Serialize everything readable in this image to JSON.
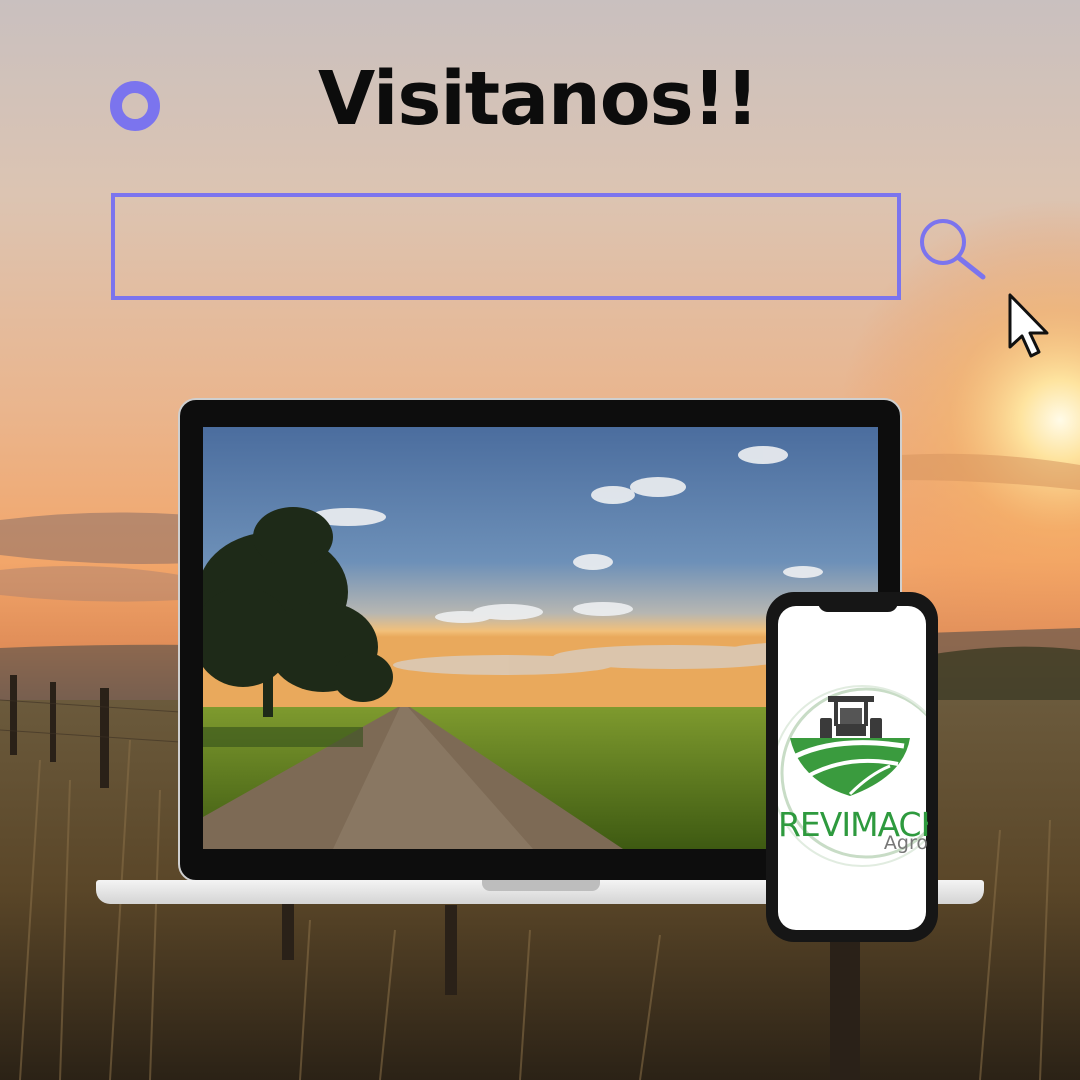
{
  "header": {
    "title": "Visitanos!!"
  },
  "search": {
    "value": "",
    "placeholder": ""
  },
  "phone_app": {
    "brand": "REVIMACK",
    "subtitle": "Agro"
  },
  "colors": {
    "accent": "#7b74ee",
    "brand_green": "#2e9a3e"
  },
  "icons": {
    "decoration": "ring-icon",
    "search": "search-icon",
    "pointer": "mouse-pointer-icon",
    "logo": "tractor-logo-icon"
  }
}
